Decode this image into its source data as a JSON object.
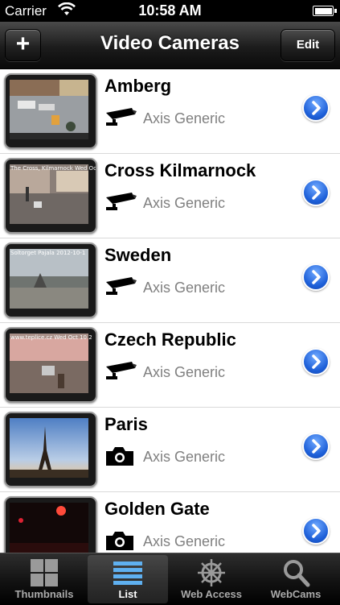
{
  "status": {
    "carrier": "Carrier",
    "time": "10:58 AM"
  },
  "nav": {
    "title": "Video Cameras",
    "add_label": "+",
    "edit_label": "Edit"
  },
  "cameras": [
    {
      "name": "Amberg",
      "model": "Axis Generic",
      "icon": "cctv-camera-icon"
    },
    {
      "name": "Cross Kilmarnock",
      "model": "Axis Generic",
      "icon": "cctv-camera-icon",
      "caption": "The Cross, Kilmarnock Wed Oc"
    },
    {
      "name": "Sweden",
      "model": "Axis Generic",
      "icon": "cctv-camera-icon",
      "caption": "Soltorget Pajala 2012-10-1"
    },
    {
      "name": "Czech Republic",
      "model": "Axis Generic",
      "icon": "cctv-camera-icon",
      "caption": "www.teplice.cz Wed Oct 10 2"
    },
    {
      "name": "Paris",
      "model": "Axis Generic",
      "icon": "photo-camera-icon"
    },
    {
      "name": "Golden Gate",
      "model": "Axis Generic",
      "icon": "photo-camera-icon"
    }
  ],
  "tabs": [
    {
      "label": "Thumbnails",
      "icon": "grid-icon"
    },
    {
      "label": "List",
      "icon": "list-icon",
      "selected": true
    },
    {
      "label": "Web Access",
      "icon": "ship-wheel-icon"
    },
    {
      "label": "WebCams",
      "icon": "magnifier-icon"
    }
  ],
  "colors": {
    "accent_blue": "#1d5fd8",
    "nav_bg": "#1c1c1c",
    "model_text": "#808080"
  }
}
